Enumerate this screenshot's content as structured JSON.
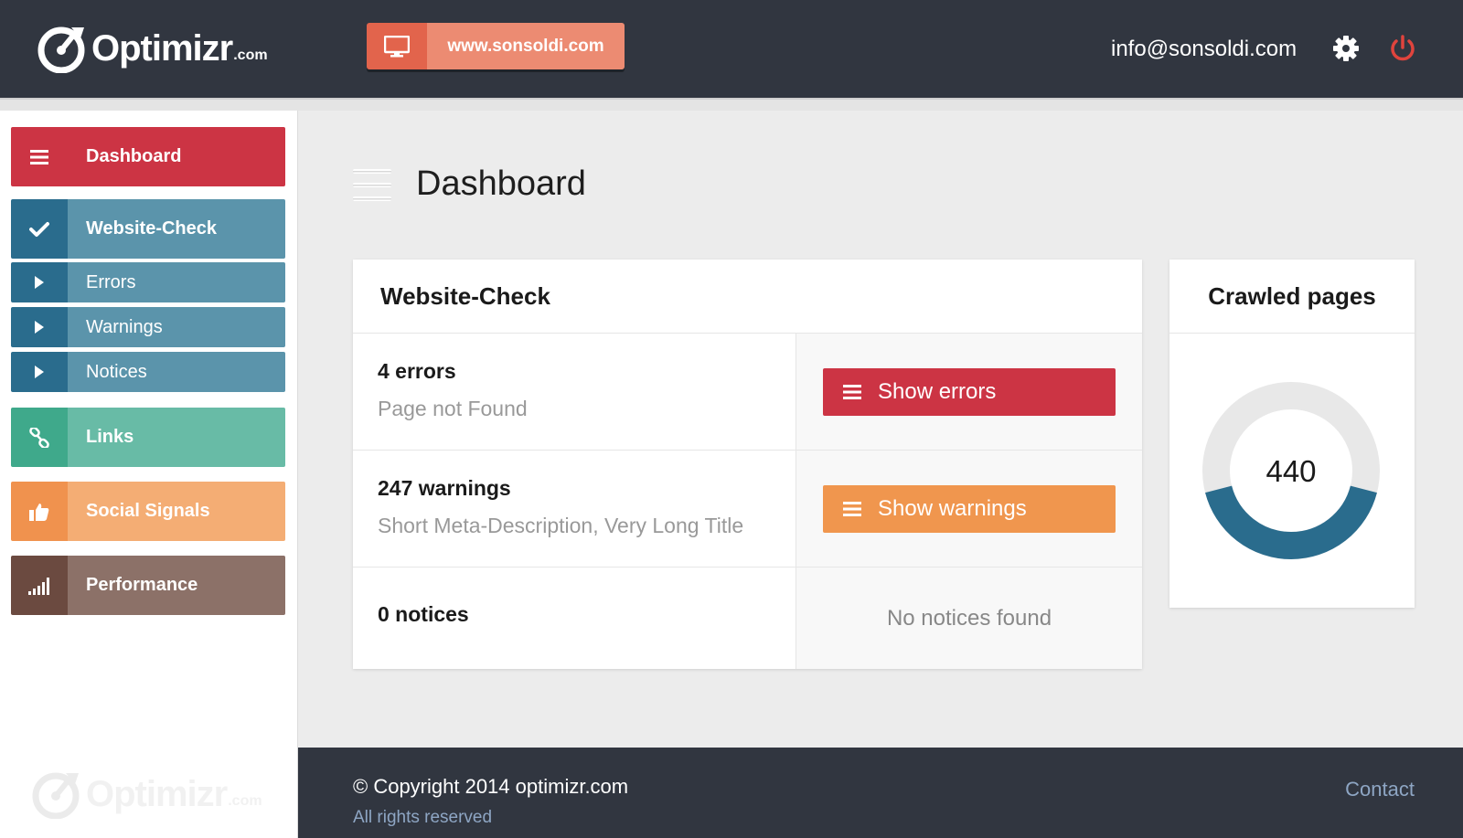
{
  "header": {
    "logo_text": "Optimizr",
    "logo_suffix": ".com",
    "site_button_label": "www.sonsoldi.com",
    "user_email": "info@sonsoldi.com",
    "icons": [
      "monitor-icon",
      "gear-icon",
      "power-icon"
    ]
  },
  "sidebar": {
    "items": [
      {
        "label": "Dashboard",
        "icon": "hamburger-menu-icon"
      },
      {
        "label": "Website-Check",
        "icon": "checkmark-icon"
      },
      {
        "label": "Errors",
        "icon": "triangle-right-icon"
      },
      {
        "label": "Warnings",
        "icon": "triangle-right-icon"
      },
      {
        "label": "Notices",
        "icon": "triangle-right-icon"
      },
      {
        "label": "Links",
        "icon": "chain-link-icon"
      },
      {
        "label": "Social Signals",
        "icon": "thumbs-up-icon"
      },
      {
        "label": "Performance",
        "icon": "signal-bars-icon"
      }
    ],
    "footer_logo_text": "Optimizr",
    "footer_logo_suffix": ".com"
  },
  "main": {
    "title": "Dashboard",
    "website_check": {
      "title": "Website-Check",
      "rows": [
        {
          "count": "4 errors",
          "description": "Page not Found",
          "action": "Show errors"
        },
        {
          "count": "247 warnings",
          "description": "Short Meta-Description, Very Long Title",
          "action": "Show warnings"
        },
        {
          "count": "0 notices",
          "description": "",
          "empty_text": "No notices found"
        }
      ]
    },
    "crawled": {
      "title": "Crawled pages",
      "value": "440",
      "ring_fill_fraction": 0.42
    }
  },
  "footer": {
    "copyright": "© Copyright 2014 optimizr.com",
    "rights": "All rights reserved",
    "contact": "Contact"
  },
  "colors": {
    "header_bg": "#313640",
    "red": "#cc3444",
    "orange": "#f0964e",
    "teal_dark": "#2a6c8d",
    "green": "#3fa98b",
    "brown": "#6b4a40"
  }
}
